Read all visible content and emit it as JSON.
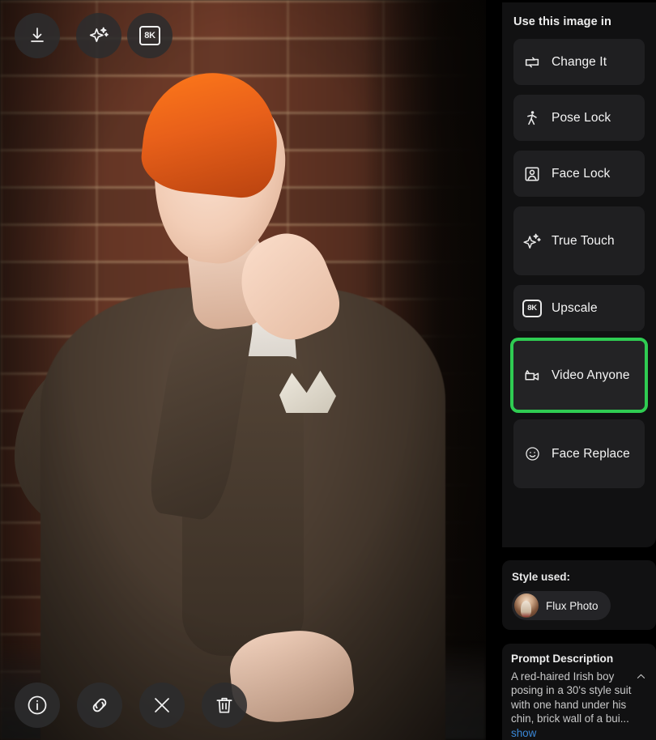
{
  "viewer": {
    "alt": "A red-haired Irish boy posing in a 30's style suit with one hand under his chin, brick wall background",
    "top_tools": [
      {
        "name": "download-icon",
        "label": "Download"
      },
      {
        "name": "enhance-sparkle-icon",
        "label": "Enhance"
      },
      {
        "name": "upscale-8k-icon",
        "label": "8K",
        "badge": "8K"
      }
    ],
    "bottom_tools": [
      {
        "name": "info-icon",
        "label": "Info"
      },
      {
        "name": "link-icon",
        "label": "Copy link"
      },
      {
        "name": "x-icon",
        "label": "Share on X"
      },
      {
        "name": "trash-icon",
        "label": "Delete"
      }
    ]
  },
  "sidebar": {
    "actions_title": "Use this image in",
    "actions": [
      {
        "id": "change-it",
        "label": "Change It",
        "icon": "swap-arrows-icon",
        "selected": false,
        "two_line": false
      },
      {
        "id": "pose-lock",
        "label": "Pose Lock",
        "icon": "walking-person-icon",
        "selected": false,
        "two_line": false
      },
      {
        "id": "face-lock",
        "label": "Face Lock",
        "icon": "portrait-frame-icon",
        "selected": false,
        "two_line": false
      },
      {
        "id": "true-touch",
        "label": "True Touch",
        "icon": "sparkle-icon",
        "selected": false,
        "two_line": true
      },
      {
        "id": "upscale",
        "label": "Upscale",
        "icon": "upscale-8k-icon",
        "selected": false,
        "two_line": false,
        "badge": "8K"
      },
      {
        "id": "video-anyone",
        "label": "Video Anyone",
        "icon": "video-camera-icon",
        "selected": true,
        "two_line": true
      },
      {
        "id": "face-replace",
        "label": "Face Replace",
        "icon": "smiley-face-icon",
        "selected": false,
        "two_line": true
      }
    ],
    "style": {
      "title": "Style used:",
      "name": "Flux Photo"
    },
    "prompt": {
      "title": "Prompt Description",
      "text": "A red-haired Irish boy posing in a 30's style suit with one hand under his chin, brick wall of a bui...",
      "show_more": "show",
      "collapse_icon": "chevron-up-icon"
    }
  },
  "colors": {
    "selection_green": "#2fcc52",
    "panel_bg": "#111112",
    "button_bg": "#1f1f21",
    "link_blue": "#3a87d6",
    "page_bg": "#000000"
  }
}
